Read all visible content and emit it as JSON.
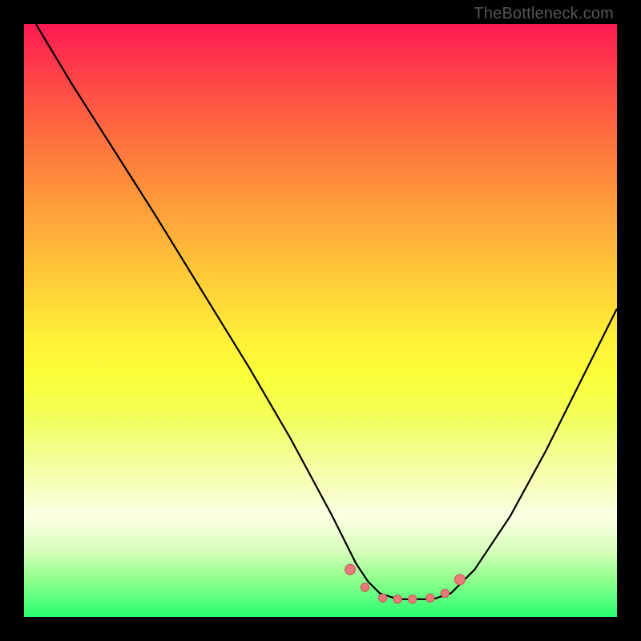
{
  "watermark": "TheBottleneck.com",
  "colors": {
    "frame": "#000000",
    "curve_stroke": "#000000",
    "marker_fill": "#e97a7a",
    "marker_stroke": "#c75555",
    "gradient_top": "#ff1a53",
    "gradient_bottom": "#28ff70"
  },
  "chart_data": {
    "type": "line",
    "title": "",
    "xlabel": "",
    "ylabel": "",
    "xlim": [
      0,
      100
    ],
    "ylim": [
      0,
      100
    ],
    "grid": false,
    "series": [
      {
        "name": "curve",
        "x": [
          2,
          8,
          15,
          22,
          30,
          38,
          45,
          52,
          56,
          58,
          60,
          63,
          66,
          69,
          72,
          76,
          82,
          88,
          94,
          100
        ],
        "y": [
          100,
          90,
          79,
          68,
          55,
          42,
          30,
          17,
          9,
          6,
          4,
          3,
          3,
          3,
          4,
          8,
          17,
          28,
          40,
          52
        ]
      }
    ],
    "markers": {
      "name": "highlight-points",
      "x": [
        55,
        57.5,
        60.5,
        63,
        65.5,
        68.5,
        71,
        73.5
      ],
      "y": [
        8,
        5,
        3.2,
        3,
        3,
        3.2,
        4,
        6.3
      ]
    }
  }
}
